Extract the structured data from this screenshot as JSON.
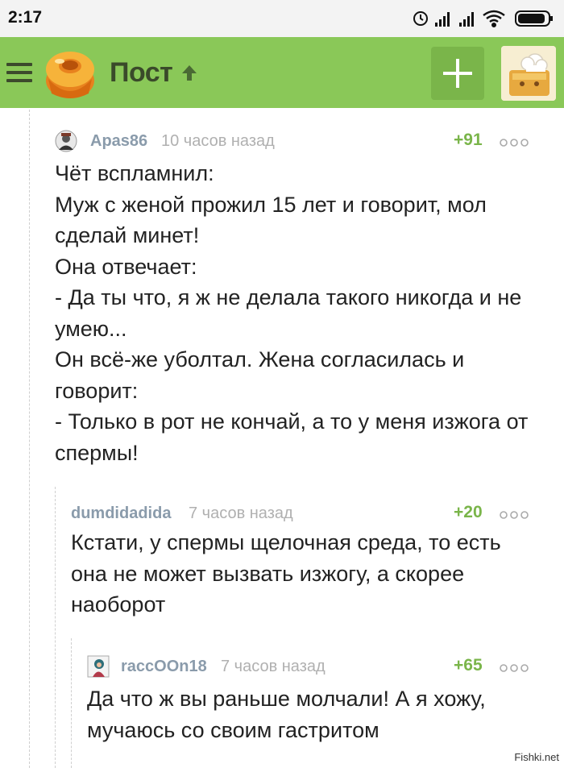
{
  "status_bar": {
    "time": "2:17"
  },
  "app_bar": {
    "title": "Пост",
    "menu_icon": "hamburger-menu-icon",
    "logo_icon": "pikabu-cupcake-logo",
    "add_icon": "plus-icon",
    "colors": {
      "bar": "#8ac858",
      "title": "#3a4a2a",
      "add_button": "#7ab54a"
    }
  },
  "comments": [
    {
      "author": "Apas86",
      "time": "10 часов назад",
      "rating": "+91",
      "text": "Чёт вспламнил:\nМуж с женой прожил 15 лет и говорит, мол сделай минет!\nОна отвечает:\n- Да ты что, я ж не делала такого никогда и не умею...\nОн всё-же уболтал. Жена согласилась и говорит:\n- Только в рот не кончай, а то у меня изжога от спермы!"
    },
    {
      "author": "dumdidadida",
      "time": "7 часов назад",
      "rating": "+20",
      "text": "Кстати, у спермы щелочная среда, то есть она не может вызвать изжогу, а скорее наоборот"
    },
    {
      "author": "raccOOn18",
      "time": "7 часов назад",
      "rating": "+65",
      "text": "Да что ж вы раньше молчали! А я хожу, мучаюсь со своим гастритом"
    }
  ],
  "colors": {
    "author": "#8a9bab",
    "time": "#b0b0b0",
    "rating": "#7ab54a",
    "text": "#222222"
  },
  "watermark": "Fishki.net"
}
